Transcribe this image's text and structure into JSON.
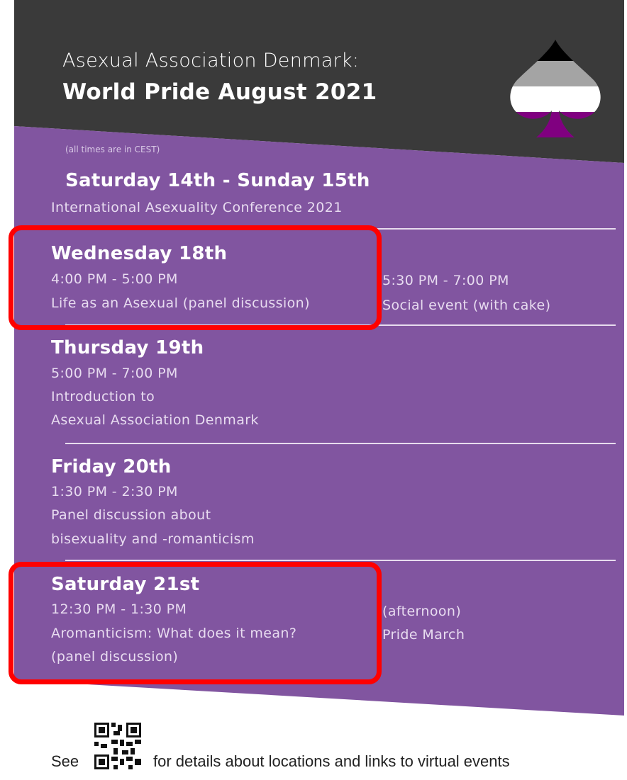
{
  "header": {
    "line1": "Asexual Association Denmark:",
    "line2": "World Pride August 2021"
  },
  "timezone_note": "(all times are in CEST)",
  "events": [
    {
      "day": "Saturday 14th - Sunday 15th",
      "lines": [
        "International Asexuality Conference 2021"
      ]
    },
    {
      "day": "Wednesday 18th",
      "lines": [
        "4:00 PM - 5:00 PM",
        "Life as an Asexual (panel discussion)"
      ],
      "side": [
        "5:30 PM - 7:00 PM",
        "Social event (with cake)"
      ]
    },
    {
      "day": "Thursday 19th",
      "lines": [
        "5:00 PM - 7:00 PM",
        "Introduction to",
        "Asexual Association Denmark"
      ]
    },
    {
      "day": "Friday 20th",
      "lines": [
        "1:30 PM - 2:30 PM",
        "Panel discussion about",
        "bisexuality and -romanticism"
      ]
    },
    {
      "day": "Saturday 21st",
      "lines": [
        "12:30 PM - 1:30 PM",
        "Aromanticism: What does it mean?",
        "(panel discussion)"
      ],
      "side": [
        "(afternoon)",
        "Pride March"
      ]
    }
  ],
  "footer": {
    "see": "See",
    "details": "for details about locations and links to virtual events",
    "qr_icon": "qr-code-icon"
  },
  "colors": {
    "header_bg": "#3a3a3a",
    "purple": "#8155a0",
    "highlight": "#ff0000",
    "flag_black": "#000000",
    "flag_gray": "#a4a4a4",
    "flag_white": "#ffffff",
    "flag_purple": "#800080"
  }
}
